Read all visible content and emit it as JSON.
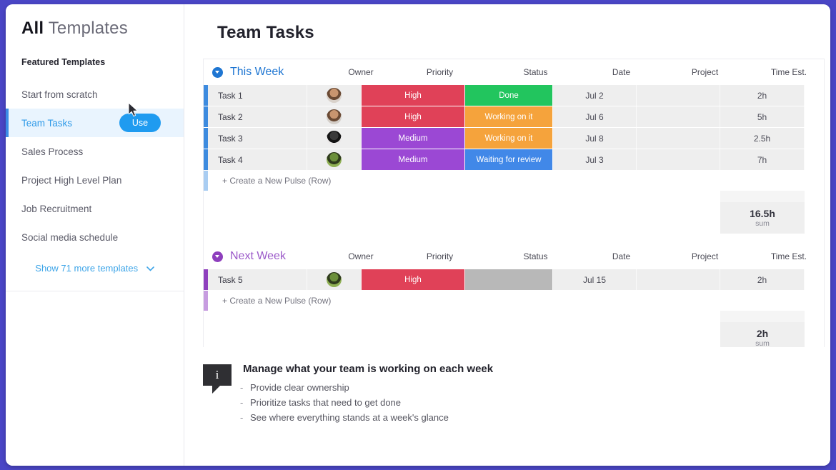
{
  "theme": {
    "frame_color": "#4a46c6",
    "accent_blue": "#1f9bf0",
    "link_blue": "#3ea5e8"
  },
  "sidebar": {
    "title_bold": "All",
    "title_rest": "Templates",
    "section_label": "Featured Templates",
    "items": [
      {
        "label": "Start from scratch",
        "active": false
      },
      {
        "label": "Team Tasks",
        "active": true
      },
      {
        "label": "Sales Process",
        "active": false
      },
      {
        "label": "Project High Level Plan",
        "active": false
      },
      {
        "label": "Job Recruitment",
        "active": false
      },
      {
        "label": "Social media schedule",
        "active": false
      }
    ],
    "use_button": "Use",
    "show_more": "Show 71 more templates",
    "chevron": "⌄"
  },
  "main": {
    "page_title": "Team Tasks",
    "columns": [
      "Owner",
      "Priority",
      "Status",
      "Date",
      "Project",
      "Time Est."
    ],
    "new_row_label": "+ Create a New Pulse (Row)",
    "sum_label": "sum",
    "groups": [
      {
        "name": "This Week",
        "color": "#1f76d2",
        "toggle_color": "#1f76d2",
        "row_accent": "#3d8bdf",
        "new_row_accent": "#a9cdf2",
        "rows": [
          {
            "name": "Task 1",
            "owner": "avatar-person-1",
            "priority": "High",
            "priority_color": "#e04158",
            "status": "Done",
            "status_color": "#22c55e",
            "date": "Jul 2",
            "project": "",
            "time": "2h"
          },
          {
            "name": "Task 2",
            "owner": "avatar-person-2",
            "priority": "High",
            "priority_color": "#e04158",
            "status": "Working on it",
            "status_color": "#f5a33c",
            "date": "Jul 6",
            "project": "",
            "time": "5h"
          },
          {
            "name": "Task 3",
            "owner": "avatar-person-3",
            "priority": "Medium",
            "priority_color": "#9b48d4",
            "status": "Working on it",
            "status_color": "#f5a33c",
            "date": "Jul 8",
            "project": "",
            "time": "2.5h"
          },
          {
            "name": "Task 4",
            "owner": "avatar-person-4",
            "priority": "Medium",
            "priority_color": "#9b48d4",
            "status": "Waiting for review",
            "status_color": "#4188e8",
            "date": "Jul 3",
            "project": "",
            "time": "7h"
          }
        ],
        "sum_value": "16.5h"
      },
      {
        "name": "Next Week",
        "color": "#9b59c9",
        "toggle_color": "#8e3fbd",
        "row_accent": "#8e3fbd",
        "new_row_accent": "#c79ce0",
        "rows": [
          {
            "name": "Task 5",
            "owner": "avatar-person-4",
            "priority": "High",
            "priority_color": "#e04158",
            "status": "",
            "status_color": "#b8b8b8",
            "date": "Jul 15",
            "project": "",
            "time": "2h"
          }
        ],
        "sum_value": "2h"
      }
    ]
  },
  "info": {
    "icon": "info-icon",
    "icon_glyph": "i",
    "title": "Manage what your team is working on each week",
    "bullets": [
      "Provide clear ownership",
      "Prioritize tasks that need to get done",
      "See where everything stands at a week's glance"
    ]
  }
}
